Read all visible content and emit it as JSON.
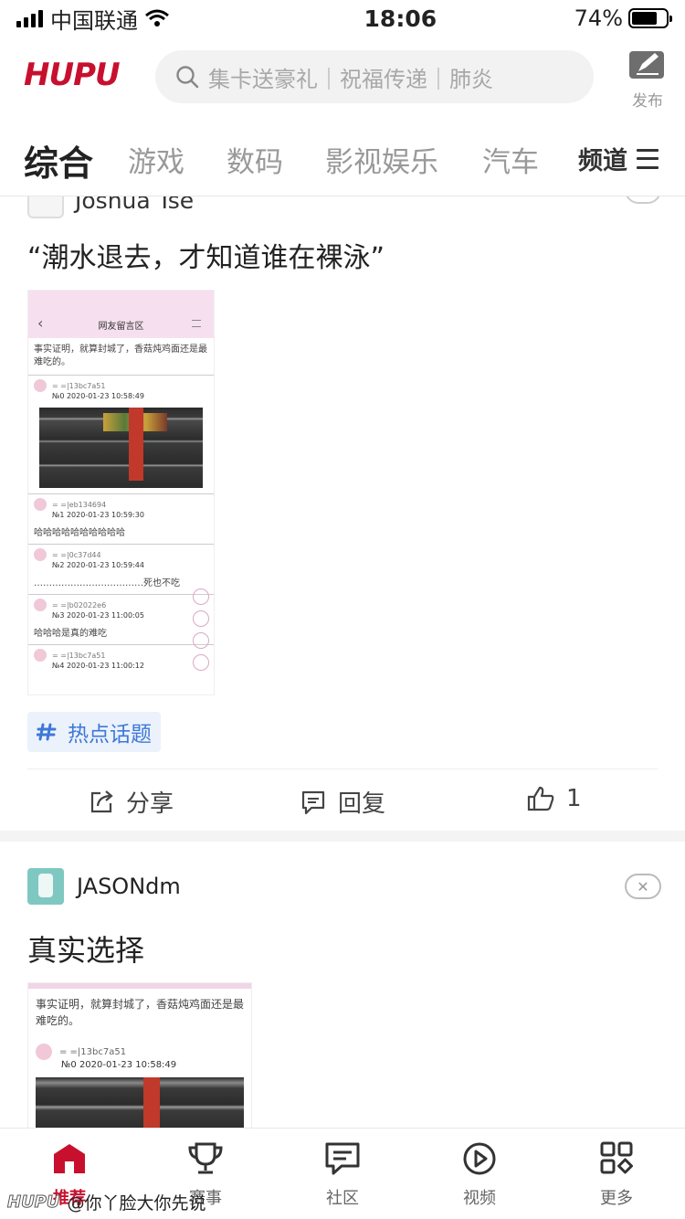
{
  "status_bar": {
    "carrier": "中国联通",
    "time": "18:06",
    "battery_percent": "74%",
    "battery_level": 0.74
  },
  "header": {
    "logo_text": "HUPU",
    "search_placeholder": "集卡送豪礼｜祝福传递｜肺炎",
    "publish_label": "发布"
  },
  "tabs": {
    "items": [
      "综合",
      "游戏",
      "数码",
      "影视娱乐",
      "汽车"
    ],
    "channels_label": "频道"
  },
  "post1": {
    "author_cut": "Joshua Tse",
    "title": "“潮水退去，才知道谁在裸泳”",
    "screenshot": {
      "header_title": "网友留言区",
      "intro": "事实证明，就算封城了，香菇炖鸡面还是最难吃的。",
      "comments": [
        {
          "uid": "= =|13bc7a51",
          "no": "№0   2020-01-23 10:58:49",
          "text": ""
        },
        {
          "uid": "= =|eb134694",
          "no": "№1   2020-01-23 10:59:30",
          "text": "哈哈哈哈哈哈哈哈哈哈"
        },
        {
          "uid": "= =|0c37d44",
          "no": "№2   2020-01-23 10:59:44",
          "text": "………………………………死也不吃"
        },
        {
          "uid": "= =|b02022e6",
          "no": "№3   2020-01-23 11:00:05",
          "text": "哈哈哈是真的难吃"
        },
        {
          "uid": "= =|13bc7a51",
          "no": "№4   2020-01-23 11:00:12",
          "text": ""
        }
      ]
    },
    "hashtag": "热点话题",
    "share_label": "分享",
    "reply_label": "回复",
    "like_count": "1"
  },
  "post2": {
    "author": "JASONdm",
    "title": "真实选择",
    "screenshot": {
      "intro": "事实证明，就算封城了，香菇炖鸡面还是最难吃的。",
      "uid": "= =|13bc7a51",
      "no": "№0  2020-01-23 10:58:49"
    }
  },
  "bottom_nav": {
    "items": [
      "推荐",
      "赛事",
      "社区",
      "视频",
      "更多"
    ],
    "active_index": 0
  },
  "watermark": {
    "logo": "HUPU",
    "text": "@你丫脸大你先说"
  },
  "colors": {
    "brand": "#c8102e",
    "hashtag_text": "#3f78d8",
    "hashtag_bg": "#ebf2fb"
  }
}
